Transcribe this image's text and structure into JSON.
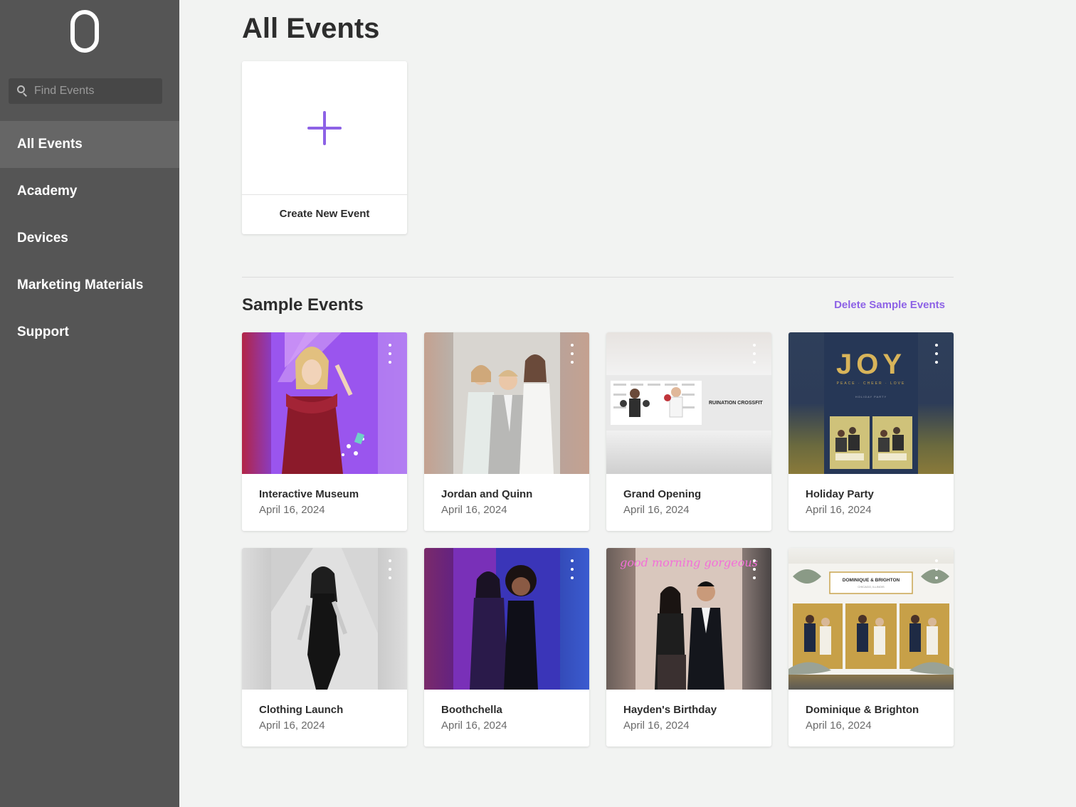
{
  "sidebar": {
    "search": {
      "placeholder": "Find Events"
    },
    "nav": [
      {
        "label": "All Events",
        "active": true
      },
      {
        "label": "Academy"
      },
      {
        "label": "Devices"
      },
      {
        "label": "Marketing Materials"
      },
      {
        "label": "Support"
      }
    ]
  },
  "main": {
    "title": "All Events",
    "create_card": {
      "label": "Create New Event",
      "icon": "plus-icon"
    },
    "sample_section": {
      "title": "Sample Events",
      "delete_label": "Delete Sample Events",
      "events": [
        {
          "name": "Interactive Museum",
          "date": "April 16, 2024"
        },
        {
          "name": "Jordan and Quinn",
          "date": "April 16, 2024"
        },
        {
          "name": "Grand Opening",
          "date": "April 16, 2024"
        },
        {
          "name": "Holiday Party",
          "date": "April 16, 2024"
        },
        {
          "name": "Clothing Launch",
          "date": "April 16, 2024"
        },
        {
          "name": "Boothchella",
          "date": "April 16, 2024"
        },
        {
          "name": "Hayden's Birthday",
          "date": "April 16, 2024"
        },
        {
          "name": "Dominique & Brighton",
          "date": "April 16, 2024"
        }
      ]
    }
  },
  "thumbnails": {
    "grand_opening_banner": "RUINATION CROSSFIT",
    "holiday_title": "JOY",
    "holiday_subtitle": "PEACE · CHEER · LOVE",
    "holiday_caption": "HOLIDAY PARTY",
    "birthday_neon": "good morning gorgeous",
    "wedding_names": "DOMINIQUE & BRIGHTON",
    "wedding_location": "CHICAGO, ILLINOIS"
  },
  "colors": {
    "sidebar_bg": "#555555",
    "sidebar_active": "#666666",
    "page_bg": "#f2f3f2",
    "accent": "#8d62e6"
  }
}
